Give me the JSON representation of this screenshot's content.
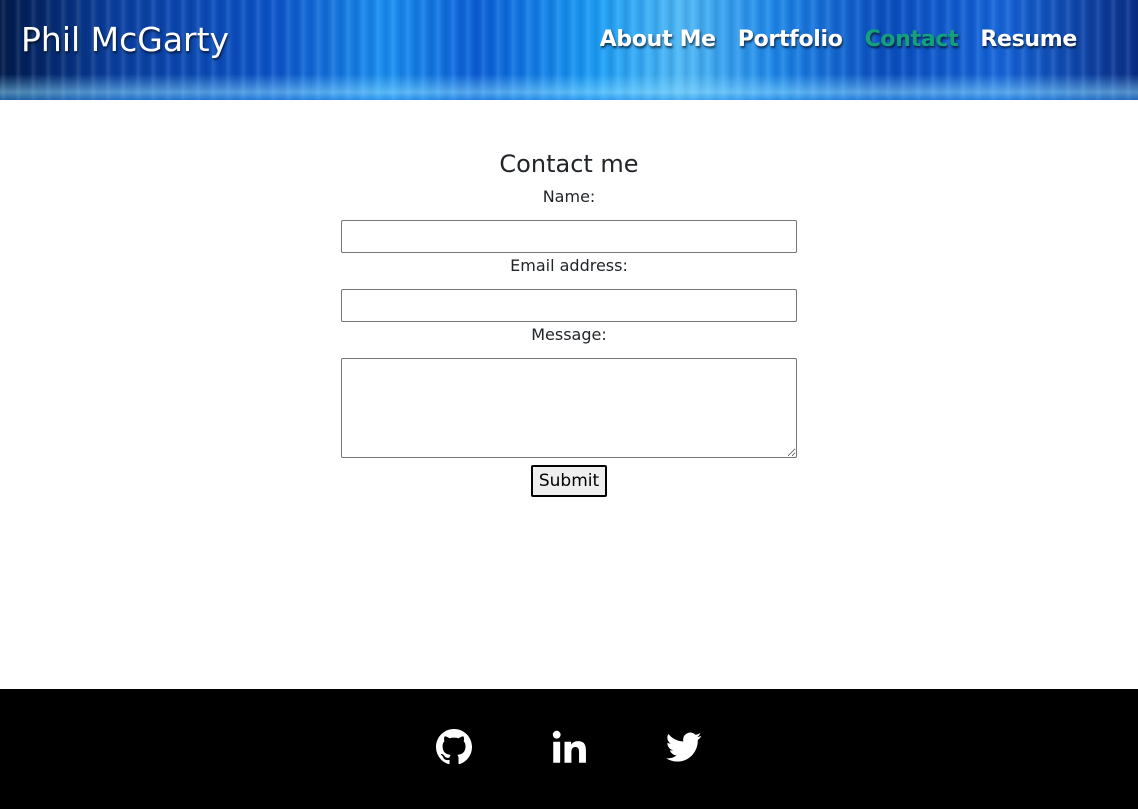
{
  "header": {
    "brand": "Phil McGarty",
    "nav": [
      {
        "label": "About Me",
        "active": false
      },
      {
        "label": "Portfolio",
        "active": false
      },
      {
        "label": "Contact",
        "active": true
      },
      {
        "label": "Resume",
        "active": false
      }
    ]
  },
  "contact": {
    "title": "Contact me",
    "name_label": "Name:",
    "name_value": "",
    "email_label": "Email address:",
    "email_value": "",
    "message_label": "Message:",
    "message_value": "",
    "submit_label": "Submit"
  },
  "footer": {
    "social": [
      {
        "icon": "github-icon"
      },
      {
        "icon": "linkedin-icon"
      },
      {
        "icon": "twitter-icon"
      }
    ]
  },
  "colors": {
    "active_nav": "#14a07a",
    "footer_bg": "#000000"
  }
}
